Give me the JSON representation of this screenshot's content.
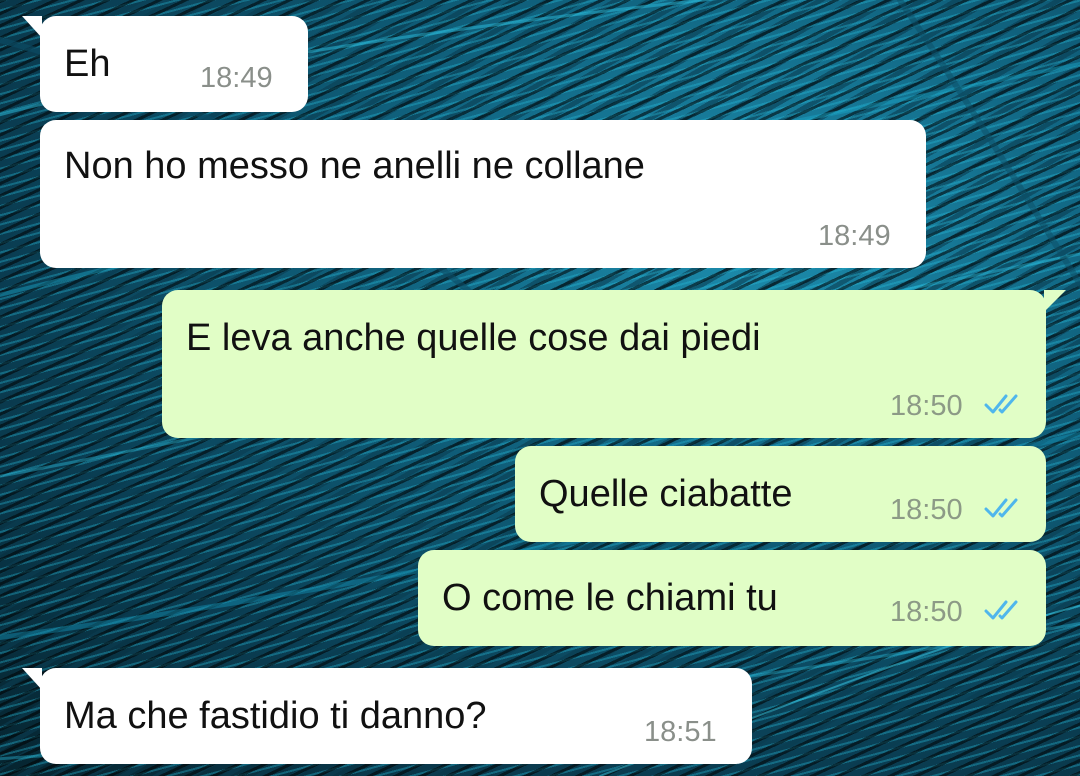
{
  "messages": [
    {
      "text": "Eh",
      "time": "18:49",
      "direction": "incoming"
    },
    {
      "text": "Non ho messo ne anelli ne collane",
      "time": "18:49",
      "direction": "incoming"
    },
    {
      "text": "E leva anche quelle cose dai piedi",
      "time": "18:50",
      "direction": "outgoing",
      "status": "read"
    },
    {
      "text": "Quelle ciabatte",
      "time": "18:50",
      "direction": "outgoing",
      "status": "read"
    },
    {
      "text": "O come le chiami tu",
      "time": "18:50",
      "direction": "outgoing",
      "status": "read"
    },
    {
      "text": "Ma che fastidio ti danno?",
      "time": "18:51",
      "direction": "incoming"
    }
  ],
  "colors": {
    "incoming_bubble": "#ffffff",
    "outgoing_bubble": "#e1fec6",
    "read_ticks": "#4fb6ec"
  },
  "icons": {
    "read_receipt": "double-check-icon"
  }
}
